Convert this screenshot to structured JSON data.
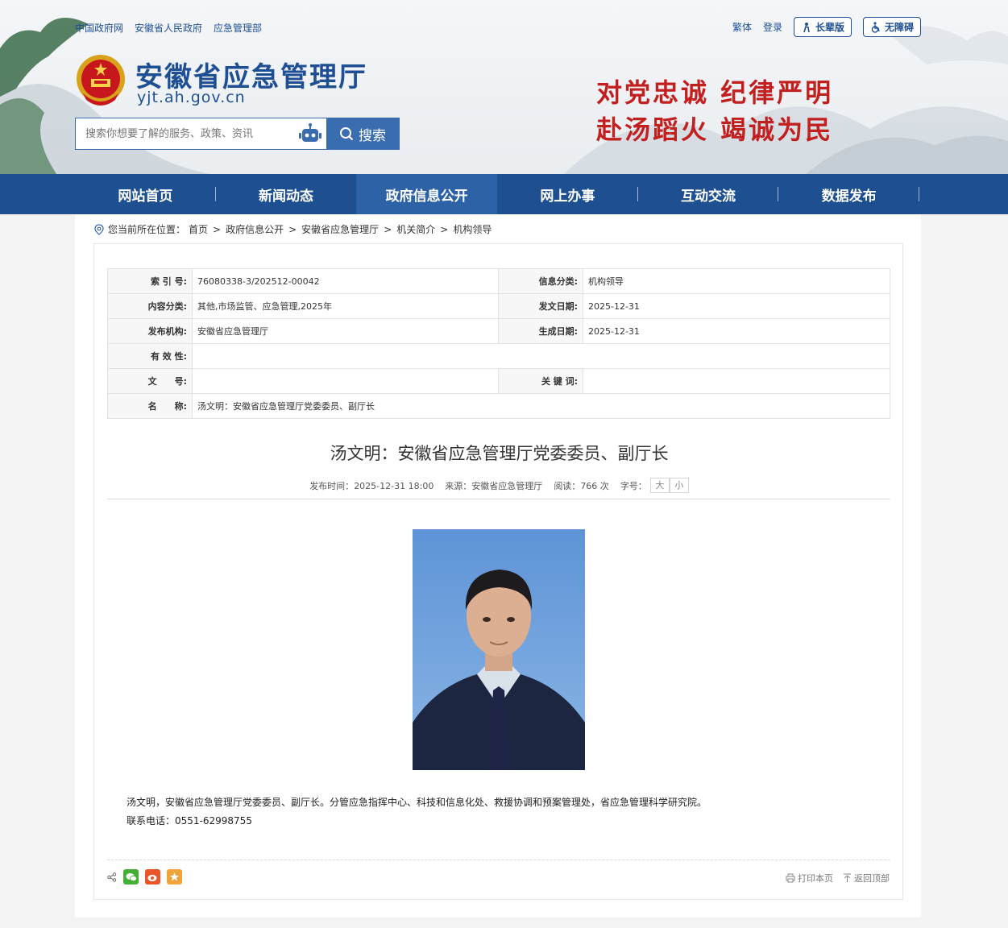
{
  "header": {
    "top_links": [
      "中国政府网",
      "安徽省人民政府",
      "应急管理部"
    ],
    "top_right": {
      "traditional": "繁体",
      "login": "登录",
      "elder": "长辈版",
      "accessible": "无障碍"
    },
    "site_title": "安徽省应急管理厅",
    "site_url": "yjt.ah.gov.cn",
    "search_placeholder": "搜索你想要了解的服务、政策、资讯",
    "search_button": "搜索",
    "slogan_line1": "对党忠诚  纪律严明",
    "slogan_line2": "赴汤蹈火  竭诚为民"
  },
  "nav": {
    "items": [
      "网站首页",
      "新闻动态",
      "政府信息公开",
      "网上办事",
      "互动交流",
      "数据发布"
    ],
    "active_index": 2
  },
  "breadcrumb": {
    "prefix": "您当前所在位置：",
    "items": [
      "首页",
      "政府信息公开",
      "安徽省应急管理厅",
      "机关简介",
      "机构领导"
    ]
  },
  "meta": {
    "index_label": "索 引 号:",
    "index_value": "76080338-3/202512-00042",
    "category_label": "信息分类:",
    "category_value": "机构领导",
    "content_label": "内容分类:",
    "content_value": "其他,市场监管、应急管理,2025年",
    "issue_date_label": "发文日期:",
    "issue_date_value": "2025-12-31",
    "org_label": "发布机构:",
    "org_value": "安徽省应急管理厅",
    "gen_date_label": "生成日期:",
    "gen_date_value": "2025-12-31",
    "validity_label": "有 效 性:",
    "validity_value": "",
    "docno_label": "文　　号:",
    "docno_value": "",
    "keywords_label": "关 键 词:",
    "keywords_value": "",
    "name_label": "名　　称:",
    "name_value": "汤文明：安徽省应急管理厅党委委员、副厅长"
  },
  "article": {
    "title": "汤文明：安徽省应急管理厅党委委员、副厅长",
    "publish_label": "发布时间：",
    "publish_value": "2025-12-31 18:00",
    "source_label": "来源：",
    "source_value": "安徽省应急管理厅",
    "reads_label": "阅读：",
    "reads_value": "766 次",
    "fontsize_label": "字号：",
    "font_big": "大",
    "font_small": "小",
    "para1": "汤文明，安徽省应急管理厅党委委员、副厅长。分管应急指挥中心、科技和信息化处、救援协调和预案管理处，省应急管理科学研究院。",
    "para2": "联系电话：0551-62998755"
  },
  "footer_tools": {
    "print": "打印本页",
    "top": "返回顶部"
  },
  "colors": {
    "brand": "#1e4f90",
    "nav_active": "#2d62a6",
    "slogan": "#c21f1f"
  }
}
